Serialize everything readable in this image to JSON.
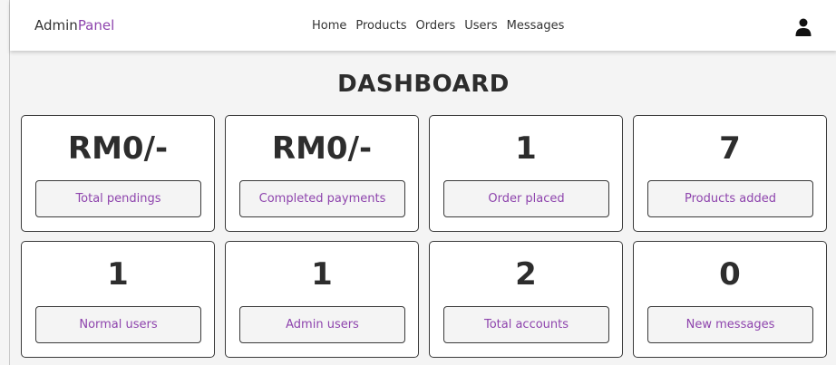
{
  "header": {
    "logo_main": "Admin",
    "logo_accent": "Panel",
    "nav": [
      "Home",
      "Products",
      "Orders",
      "Users",
      "Messages"
    ],
    "user_icon": "user-icon"
  },
  "page_title": "DASHBOARD",
  "cards": [
    {
      "value": "RM0/-",
      "label": "Total pendings"
    },
    {
      "value": "RM0/-",
      "label": "Completed payments"
    },
    {
      "value": "1",
      "label": "Order placed"
    },
    {
      "value": "7",
      "label": "Products added"
    },
    {
      "value": "1",
      "label": "Normal users"
    },
    {
      "value": "1",
      "label": "Admin users"
    },
    {
      "value": "2",
      "label": "Total accounts"
    },
    {
      "value": "0",
      "label": "New messages"
    }
  ],
  "colors": {
    "accent": "#8e44ad",
    "text": "#2d2d2d",
    "background": "#f4f4f4"
  }
}
